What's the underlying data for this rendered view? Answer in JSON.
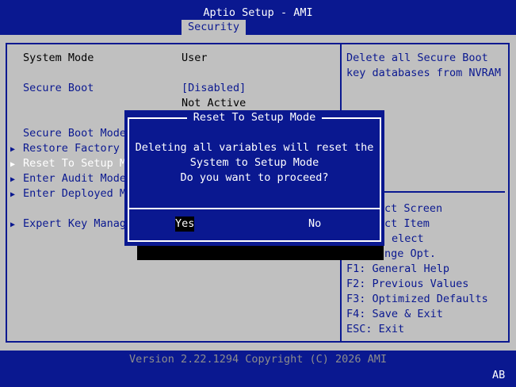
{
  "header": {
    "title": "Aptio Setup - AMI",
    "active_tab": "Security"
  },
  "settings": {
    "system_mode_label": "System Mode",
    "system_mode_value": "User",
    "secure_boot_label": "Secure Boot",
    "secure_boot_value": "[Disabled]",
    "secure_boot_status": "Not Active",
    "secure_boot_mode_label": "Secure Boot Mode",
    "restore_factory_label": "Restore Factory",
    "reset_setup_mode_label": "Reset To Setup M",
    "enter_audit_mode_label": "Enter Audit Mode",
    "enter_deployed_label": "Enter Deployed M",
    "expert_key_label": "Expert Key Manag"
  },
  "help": {
    "line1": "Delete all Secure Boot",
    "line2": "key databases from NVRAM"
  },
  "keys": [
    "ct Screen",
    "ct Item",
    "elect",
    "nge Opt.",
    "F1: General Help",
    "F2: Previous Values",
    "F3: Optimized Defaults",
    "F4: Save & Exit",
    "ESC: Exit"
  ],
  "dialog": {
    "title": "Reset To Setup Mode",
    "line1": "Deleting all variables will reset the",
    "line2": "System to Setup Mode",
    "line3": "Do you want to proceed?",
    "yes": "Yes",
    "no": "No"
  },
  "footer": {
    "version": "Version 2.22.1294 Copyright (C) 2026 AMI",
    "indicator": "AB"
  },
  "colors": {
    "bios_blue": "#0a1890",
    "panel_gray": "#c0c0c0",
    "footer_text": "#8c8c8c"
  }
}
